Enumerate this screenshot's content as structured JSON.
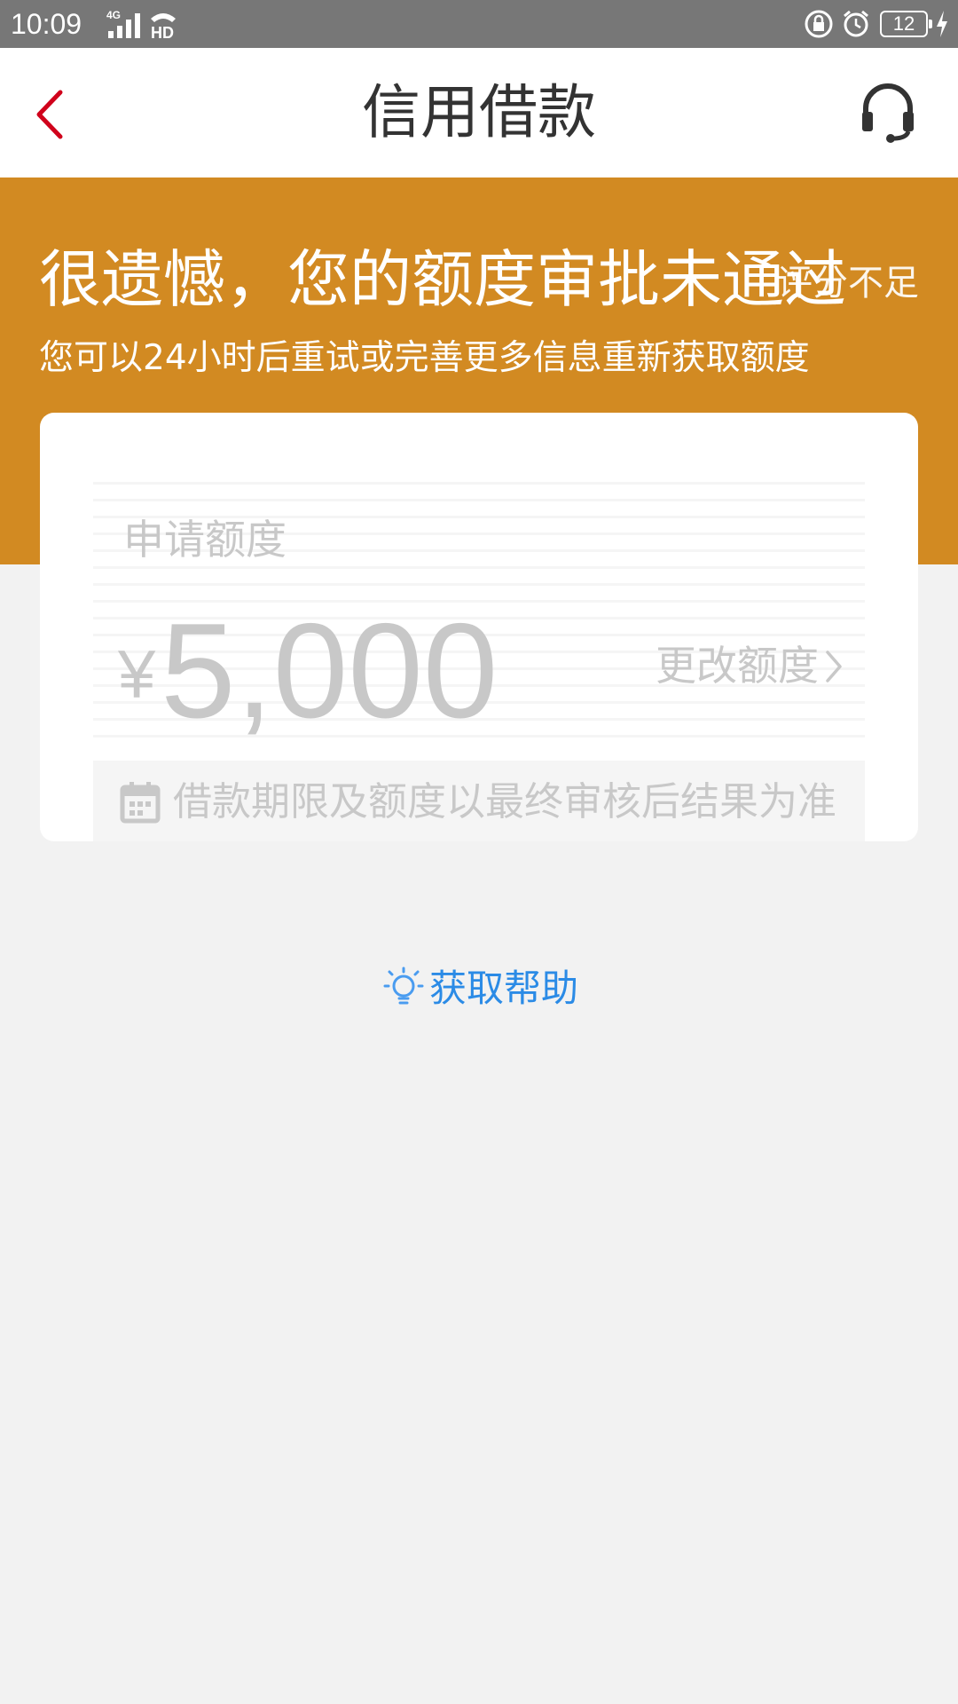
{
  "status_bar": {
    "time": "10:09",
    "network": "4G",
    "hd": "HD",
    "battery": "12"
  },
  "nav": {
    "title": "信用借款",
    "back_icon": "chevron-left-icon",
    "support_icon": "headset-icon"
  },
  "banner": {
    "headline": "很遗憾，您的额度审批未通过",
    "reason": "评分不足",
    "subtitle": "您可以24小时后重试或完善更多信息重新获取额度"
  },
  "card": {
    "apply_label": "申请额度",
    "currency": "¥",
    "amount": "5,000",
    "change_label": "更改额度",
    "notice": "借款期限及额度以最终审核后结果为准"
  },
  "help": {
    "label": "获取帮助",
    "icon": "lightbulb-icon"
  },
  "colors": {
    "banner": "#d28a22",
    "accent_red": "#d0021b",
    "link_blue": "#2b8be6",
    "disabled_gray": "#c8c8c8",
    "background": "#f2f2f2"
  }
}
